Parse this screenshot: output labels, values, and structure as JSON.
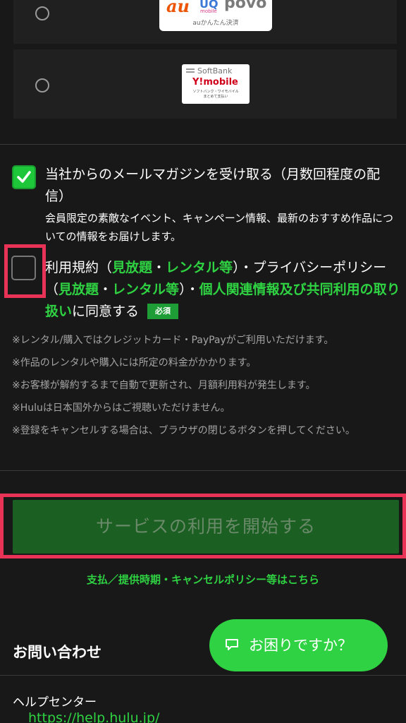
{
  "payment_options": [
    {
      "logo": {
        "brand_a": "au",
        "brand_b": "UQ",
        "brand_b_sub": "mobile",
        "brand_c": "povo",
        "caption": "auかんたん決済"
      },
      "selected": false
    },
    {
      "logo": {
        "brand_a": "SoftBank",
        "brand_b": "Y!mobile",
        "caption_1": "ソフトバンク・ワイモバイル",
        "caption_2": "まとめて支払い"
      },
      "selected": false
    }
  ],
  "newsletter": {
    "checked": true,
    "label": "当社からのメールマガジンを受け取る（月数回程度の配信）",
    "sub": "会員限定の素敵なイベント、キャンペーン情報、最新のおすすめ作品についての情報をお届けします。"
  },
  "terms": {
    "checked": false,
    "t1": "利用規約（",
    "l1": "見放題",
    "t2": "・",
    "l2": "レンタル等",
    "t3": "）・プライバシーポリシー（",
    "l3": "見放題",
    "t4": "・",
    "l4": "レンタル等",
    "t5": "）・",
    "l5": "個人関連情報及び共同利用の取り扱い",
    "t6": "に同意する",
    "badge": "必須"
  },
  "notes": [
    "※レンタル/購入ではクレジットカード・PayPayがご利用いただけます。",
    "※作品のレンタルや購入には所定の料金がかかります。",
    "※お客様が解約するまで自動で更新され、月額利用料が発生します。",
    "※Huluは日本国外からはご視聴いただけません。",
    "※登録をキャンセルする場合は、ブラウザの閉じるボタンを押してください。"
  ],
  "start_button": "サービスの利用を開始する",
  "policy_link": "支払／提供時期・キャンセルポリシー等はこちら",
  "contact": {
    "heading": "お問い合わせ",
    "help_button": "お困りですか？",
    "help_center": "ヘルプセンター",
    "help_url": "https://help.hulu.jp/"
  },
  "colors": {
    "accent": "#2fd242",
    "highlight": "#e83357",
    "background": "#181818"
  }
}
